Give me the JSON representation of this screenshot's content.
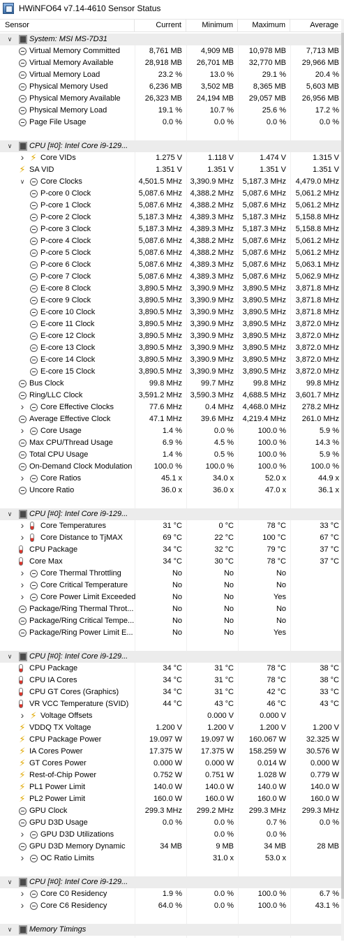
{
  "window": {
    "title": "HWiNFO64 v7.14-4610 Sensor Status"
  },
  "columns": [
    "Sensor",
    "Current",
    "Minimum",
    "Maximum",
    "Average"
  ],
  "rows": [
    {
      "t": "group",
      "label": "System: MSI MS-7D31",
      "icon": "chip-icon",
      "exp": "down",
      "lvl": 0
    },
    {
      "label": "Virtual Memory Committed",
      "icon": "clock-icon",
      "lvl": 1,
      "v": [
        "8,761 MB",
        "4,909 MB",
        "10,978 MB",
        "7,713 MB"
      ]
    },
    {
      "label": "Virtual Memory Available",
      "icon": "clock-icon",
      "lvl": 1,
      "v": [
        "28,918 MB",
        "26,701 MB",
        "32,770 MB",
        "29,966 MB"
      ]
    },
    {
      "label": "Virtual Memory Load",
      "icon": "clock-icon",
      "lvl": 1,
      "v": [
        "23.2 %",
        "13.0 %",
        "29.1 %",
        "20.4 %"
      ]
    },
    {
      "label": "Physical Memory Used",
      "icon": "clock-icon",
      "lvl": 1,
      "v": [
        "6,236 MB",
        "3,502 MB",
        "8,365 MB",
        "5,603 MB"
      ]
    },
    {
      "label": "Physical Memory Available",
      "icon": "clock-icon",
      "lvl": 1,
      "v": [
        "26,323 MB",
        "24,194 MB",
        "29,057 MB",
        "26,956 MB"
      ]
    },
    {
      "label": "Physical Memory Load",
      "icon": "clock-icon",
      "lvl": 1,
      "v": [
        "19.1 %",
        "10.7 %",
        "25.6 %",
        "17.2 %"
      ]
    },
    {
      "label": "Page File Usage",
      "icon": "clock-icon",
      "lvl": 1,
      "v": [
        "0.0 %",
        "0.0 %",
        "0.0 %",
        "0.0 %"
      ]
    },
    {
      "t": "blank"
    },
    {
      "t": "group",
      "label": "CPU [#0]: Intel Core i9-129...",
      "icon": "chip-icon",
      "exp": "down",
      "lvl": 0
    },
    {
      "label": "Core VIDs",
      "icon": "bolt-icon",
      "exp": "right",
      "lvl": 2,
      "v": [
        "1.275 V",
        "1.118 V",
        "1.474 V",
        "1.315 V"
      ]
    },
    {
      "label": "SA VID",
      "icon": "bolt-icon",
      "lvl": 1,
      "v": [
        "1.351 V",
        "1.351 V",
        "1.351 V",
        "1.351 V"
      ]
    },
    {
      "label": "Core Clocks",
      "icon": "clock-icon",
      "exp": "down",
      "lvl": 2,
      "v": [
        "4,501.5 MHz",
        "3,390.9 MHz",
        "5,187.3 MHz",
        "4,479.0 MHz"
      ]
    },
    {
      "label": "P-core 0 Clock",
      "icon": "clock-icon",
      "lvl": 3,
      "v": [
        "5,087.6 MHz",
        "4,388.2 MHz",
        "5,087.6 MHz",
        "5,061.2 MHz"
      ]
    },
    {
      "label": "P-core 1 Clock",
      "icon": "clock-icon",
      "lvl": 3,
      "v": [
        "5,087.6 MHz",
        "4,388.2 MHz",
        "5,087.6 MHz",
        "5,061.2 MHz"
      ]
    },
    {
      "label": "P-core 2 Clock",
      "icon": "clock-icon",
      "lvl": 3,
      "v": [
        "5,187.3 MHz",
        "4,389.3 MHz",
        "5,187.3 MHz",
        "5,158.8 MHz"
      ]
    },
    {
      "label": "P-core 3 Clock",
      "icon": "clock-icon",
      "lvl": 3,
      "v": [
        "5,187.3 MHz",
        "4,389.3 MHz",
        "5,187.3 MHz",
        "5,158.8 MHz"
      ]
    },
    {
      "label": "P-core 4 Clock",
      "icon": "clock-icon",
      "lvl": 3,
      "v": [
        "5,087.6 MHz",
        "4,388.2 MHz",
        "5,087.6 MHz",
        "5,061.2 MHz"
      ]
    },
    {
      "label": "P-core 5 Clock",
      "icon": "clock-icon",
      "lvl": 3,
      "v": [
        "5,087.6 MHz",
        "4,388.2 MHz",
        "5,087.6 MHz",
        "5,061.2 MHz"
      ]
    },
    {
      "label": "P-core 6 Clock",
      "icon": "clock-icon",
      "lvl": 3,
      "v": [
        "5,087.6 MHz",
        "4,389.3 MHz",
        "5,087.6 MHz",
        "5,063.1 MHz"
      ]
    },
    {
      "label": "P-core 7 Clock",
      "icon": "clock-icon",
      "lvl": 3,
      "v": [
        "5,087.6 MHz",
        "4,389.3 MHz",
        "5,087.6 MHz",
        "5,062.9 MHz"
      ]
    },
    {
      "label": "E-core 8 Clock",
      "icon": "clock-icon",
      "lvl": 3,
      "v": [
        "3,890.5 MHz",
        "3,390.9 MHz",
        "3,890.5 MHz",
        "3,871.8 MHz"
      ]
    },
    {
      "label": "E-core 9 Clock",
      "icon": "clock-icon",
      "lvl": 3,
      "v": [
        "3,890.5 MHz",
        "3,390.9 MHz",
        "3,890.5 MHz",
        "3,871.8 MHz"
      ]
    },
    {
      "label": "E-core 10 Clock",
      "icon": "clock-icon",
      "lvl": 3,
      "v": [
        "3,890.5 MHz",
        "3,390.9 MHz",
        "3,890.5 MHz",
        "3,871.8 MHz"
      ]
    },
    {
      "label": "E-core 11 Clock",
      "icon": "clock-icon",
      "lvl": 3,
      "v": [
        "3,890.5 MHz",
        "3,390.9 MHz",
        "3,890.5 MHz",
        "3,872.0 MHz"
      ]
    },
    {
      "label": "E-core 12 Clock",
      "icon": "clock-icon",
      "lvl": 3,
      "v": [
        "3,890.5 MHz",
        "3,390.9 MHz",
        "3,890.5 MHz",
        "3,872.0 MHz"
      ]
    },
    {
      "label": "E-core 13 Clock",
      "icon": "clock-icon",
      "lvl": 3,
      "v": [
        "3,890.5 MHz",
        "3,390.9 MHz",
        "3,890.5 MHz",
        "3,872.0 MHz"
      ]
    },
    {
      "label": "E-core 14 Clock",
      "icon": "clock-icon",
      "lvl": 3,
      "v": [
        "3,890.5 MHz",
        "3,390.9 MHz",
        "3,890.5 MHz",
        "3,872.0 MHz"
      ]
    },
    {
      "label": "E-core 15 Clock",
      "icon": "clock-icon",
      "lvl": 3,
      "v": [
        "3,890.5 MHz",
        "3,390.9 MHz",
        "3,890.5 MHz",
        "3,872.0 MHz"
      ]
    },
    {
      "label": "Bus Clock",
      "icon": "clock-icon",
      "lvl": 1,
      "v": [
        "99.8 MHz",
        "99.7 MHz",
        "99.8 MHz",
        "99.8 MHz"
      ]
    },
    {
      "label": "Ring/LLC Clock",
      "icon": "clock-icon",
      "lvl": 1,
      "v": [
        "3,591.2 MHz",
        "3,590.3 MHz",
        "4,688.5 MHz",
        "3,601.7 MHz"
      ]
    },
    {
      "label": "Core Effective Clocks",
      "icon": "clock-icon",
      "exp": "right",
      "lvl": 2,
      "v": [
        "77.6 MHz",
        "0.4 MHz",
        "4,468.0 MHz",
        "278.2 MHz"
      ]
    },
    {
      "label": "Average Effective Clock",
      "icon": "clock-icon",
      "lvl": 1,
      "v": [
        "47.1 MHz",
        "39.6 MHz",
        "4,219.4 MHz",
        "261.0 MHz"
      ]
    },
    {
      "label": "Core Usage",
      "icon": "clock-icon",
      "exp": "right",
      "lvl": 2,
      "v": [
        "1.4 %",
        "0.0 %",
        "100.0 %",
        "5.9 %"
      ]
    },
    {
      "label": "Max CPU/Thread Usage",
      "icon": "clock-icon",
      "lvl": 1,
      "v": [
        "6.9 %",
        "4.5 %",
        "100.0 %",
        "14.3 %"
      ]
    },
    {
      "label": "Total CPU Usage",
      "icon": "clock-icon",
      "lvl": 1,
      "v": [
        "1.4 %",
        "0.5 %",
        "100.0 %",
        "5.9 %"
      ]
    },
    {
      "label": "On-Demand Clock Modulation",
      "icon": "clock-icon",
      "lvl": 1,
      "v": [
        "100.0 %",
        "100.0 %",
        "100.0 %",
        "100.0 %"
      ]
    },
    {
      "label": "Core Ratios",
      "icon": "clock-icon",
      "exp": "right",
      "lvl": 2,
      "v": [
        "45.1 x",
        "34.0 x",
        "52.0 x",
        "44.9 x"
      ]
    },
    {
      "label": "Uncore Ratio",
      "icon": "clock-icon",
      "lvl": 1,
      "v": [
        "36.0 x",
        "36.0 x",
        "47.0 x",
        "36.1 x"
      ]
    },
    {
      "t": "blank"
    },
    {
      "t": "group",
      "label": "CPU [#0]: Intel Core i9-129...",
      "icon": "chip-icon",
      "exp": "down",
      "lvl": 0
    },
    {
      "label": "Core Temperatures",
      "icon": "thermometer-icon",
      "exp": "right",
      "lvl": 2,
      "v": [
        "31 °C",
        "0 °C",
        "78 °C",
        "33 °C"
      ]
    },
    {
      "label": "Core Distance to TjMAX",
      "icon": "thermometer-icon",
      "exp": "right",
      "lvl": 2,
      "v": [
        "69 °C",
        "22 °C",
        "100 °C",
        "67 °C"
      ]
    },
    {
      "label": "CPU Package",
      "icon": "thermometer-icon",
      "lvl": 1,
      "v": [
        "34 °C",
        "32 °C",
        "79 °C",
        "37 °C"
      ]
    },
    {
      "label": "Core Max",
      "icon": "thermometer-icon",
      "lvl": 1,
      "v": [
        "34 °C",
        "30 °C",
        "78 °C",
        "37 °C"
      ]
    },
    {
      "label": "Core Thermal Throttling",
      "icon": "clock-icon",
      "exp": "right",
      "lvl": 2,
      "v": [
        "No",
        "No",
        "No",
        ""
      ]
    },
    {
      "label": "Core Critical Temperature",
      "icon": "clock-icon",
      "exp": "right",
      "lvl": 2,
      "v": [
        "No",
        "No",
        "No",
        ""
      ]
    },
    {
      "label": "Core Power Limit Exceeded",
      "icon": "clock-icon",
      "exp": "right",
      "lvl": 2,
      "v": [
        "No",
        "No",
        "Yes",
        ""
      ]
    },
    {
      "label": "Package/Ring Thermal Throt...",
      "icon": "clock-icon",
      "lvl": 1,
      "v": [
        "No",
        "No",
        "No",
        ""
      ]
    },
    {
      "label": "Package/Ring Critical Tempe...",
      "icon": "clock-icon",
      "lvl": 1,
      "v": [
        "No",
        "No",
        "No",
        ""
      ]
    },
    {
      "label": "Package/Ring Power Limit E...",
      "icon": "clock-icon",
      "lvl": 1,
      "v": [
        "No",
        "No",
        "Yes",
        ""
      ]
    },
    {
      "t": "blank"
    },
    {
      "t": "group",
      "label": "CPU [#0]: Intel Core i9-129...",
      "icon": "chip-icon",
      "exp": "down",
      "lvl": 0
    },
    {
      "label": "CPU Package",
      "icon": "thermometer-icon",
      "lvl": 1,
      "v": [
        "34 °C",
        "31 °C",
        "78 °C",
        "38 °C"
      ]
    },
    {
      "label": "CPU IA Cores",
      "icon": "thermometer-icon",
      "lvl": 1,
      "v": [
        "34 °C",
        "31 °C",
        "78 °C",
        "38 °C"
      ]
    },
    {
      "label": "CPU GT Cores (Graphics)",
      "icon": "thermometer-icon",
      "lvl": 1,
      "v": [
        "34 °C",
        "31 °C",
        "42 °C",
        "33 °C"
      ]
    },
    {
      "label": "VR VCC Temperature (SVID)",
      "icon": "thermometer-icon",
      "lvl": 1,
      "v": [
        "44 °C",
        "43 °C",
        "46 °C",
        "43 °C"
      ]
    },
    {
      "label": "Voltage Offsets",
      "icon": "bolt-icon",
      "exp": "right",
      "lvl": 2,
      "v": [
        "",
        "0.000 V",
        "0.000 V",
        ""
      ]
    },
    {
      "label": "VDDQ TX Voltage",
      "icon": "bolt-icon",
      "lvl": 1,
      "v": [
        "1.200 V",
        "1.200 V",
        "1.200 V",
        "1.200 V"
      ]
    },
    {
      "label": "CPU Package Power",
      "icon": "bolt-icon",
      "lvl": 1,
      "v": [
        "19.097 W",
        "19.097 W",
        "160.067 W",
        "32.325 W"
      ]
    },
    {
      "label": "IA Cores Power",
      "icon": "bolt-icon",
      "lvl": 1,
      "v": [
        "17.375 W",
        "17.375 W",
        "158.259 W",
        "30.576 W"
      ]
    },
    {
      "label": "GT Cores Power",
      "icon": "bolt-icon",
      "lvl": 1,
      "v": [
        "0.000 W",
        "0.000 W",
        "0.014 W",
        "0.000 W"
      ]
    },
    {
      "label": "Rest-of-Chip Power",
      "icon": "bolt-icon",
      "lvl": 1,
      "v": [
        "0.752 W",
        "0.751 W",
        "1.028 W",
        "0.779 W"
      ]
    },
    {
      "label": "PL1 Power Limit",
      "icon": "bolt-icon",
      "lvl": 1,
      "v": [
        "140.0 W",
        "140.0 W",
        "140.0 W",
        "140.0 W"
      ]
    },
    {
      "label": "PL2 Power Limit",
      "icon": "bolt-icon",
      "lvl": 1,
      "v": [
        "160.0 W",
        "160.0 W",
        "160.0 W",
        "160.0 W"
      ]
    },
    {
      "label": "GPU Clock",
      "icon": "clock-icon",
      "lvl": 1,
      "v": [
        "299.3 MHz",
        "299.2 MHz",
        "299.3 MHz",
        "299.3 MHz"
      ]
    },
    {
      "label": "GPU D3D Usage",
      "icon": "clock-icon",
      "lvl": 1,
      "v": [
        "0.0 %",
        "0.0 %",
        "0.7 %",
        "0.0 %"
      ]
    },
    {
      "label": "GPU D3D Utilizations",
      "icon": "clock-icon",
      "exp": "right",
      "lvl": 2,
      "v": [
        "",
        "0.0 %",
        "0.0 %",
        ""
      ]
    },
    {
      "label": "GPU D3D Memory Dynamic",
      "icon": "clock-icon",
      "lvl": 1,
      "v": [
        "34 MB",
        "9 MB",
        "34 MB",
        "28 MB"
      ]
    },
    {
      "label": "OC Ratio Limits",
      "icon": "clock-icon",
      "exp": "right",
      "lvl": 2,
      "v": [
        "",
        "31.0 x",
        "53.0 x",
        ""
      ]
    },
    {
      "t": "blank"
    },
    {
      "t": "group",
      "label": "CPU [#0]: Intel Core i9-129...",
      "icon": "chip-icon",
      "exp": "down",
      "lvl": 0
    },
    {
      "label": "Core C0 Residency",
      "icon": "clock-icon",
      "exp": "right",
      "lvl": 2,
      "v": [
        "1.9 %",
        "0.0 %",
        "100.0 %",
        "6.7 %"
      ]
    },
    {
      "label": "Core C6 Residency",
      "icon": "clock-icon",
      "exp": "right",
      "lvl": 2,
      "v": [
        "64.0 %",
        "0.0 %",
        "100.0 %",
        "43.1 %"
      ]
    },
    {
      "t": "blank"
    },
    {
      "t": "group",
      "label": "Memory Timings",
      "icon": "chip-icon",
      "exp": "down",
      "lvl": 0
    }
  ]
}
